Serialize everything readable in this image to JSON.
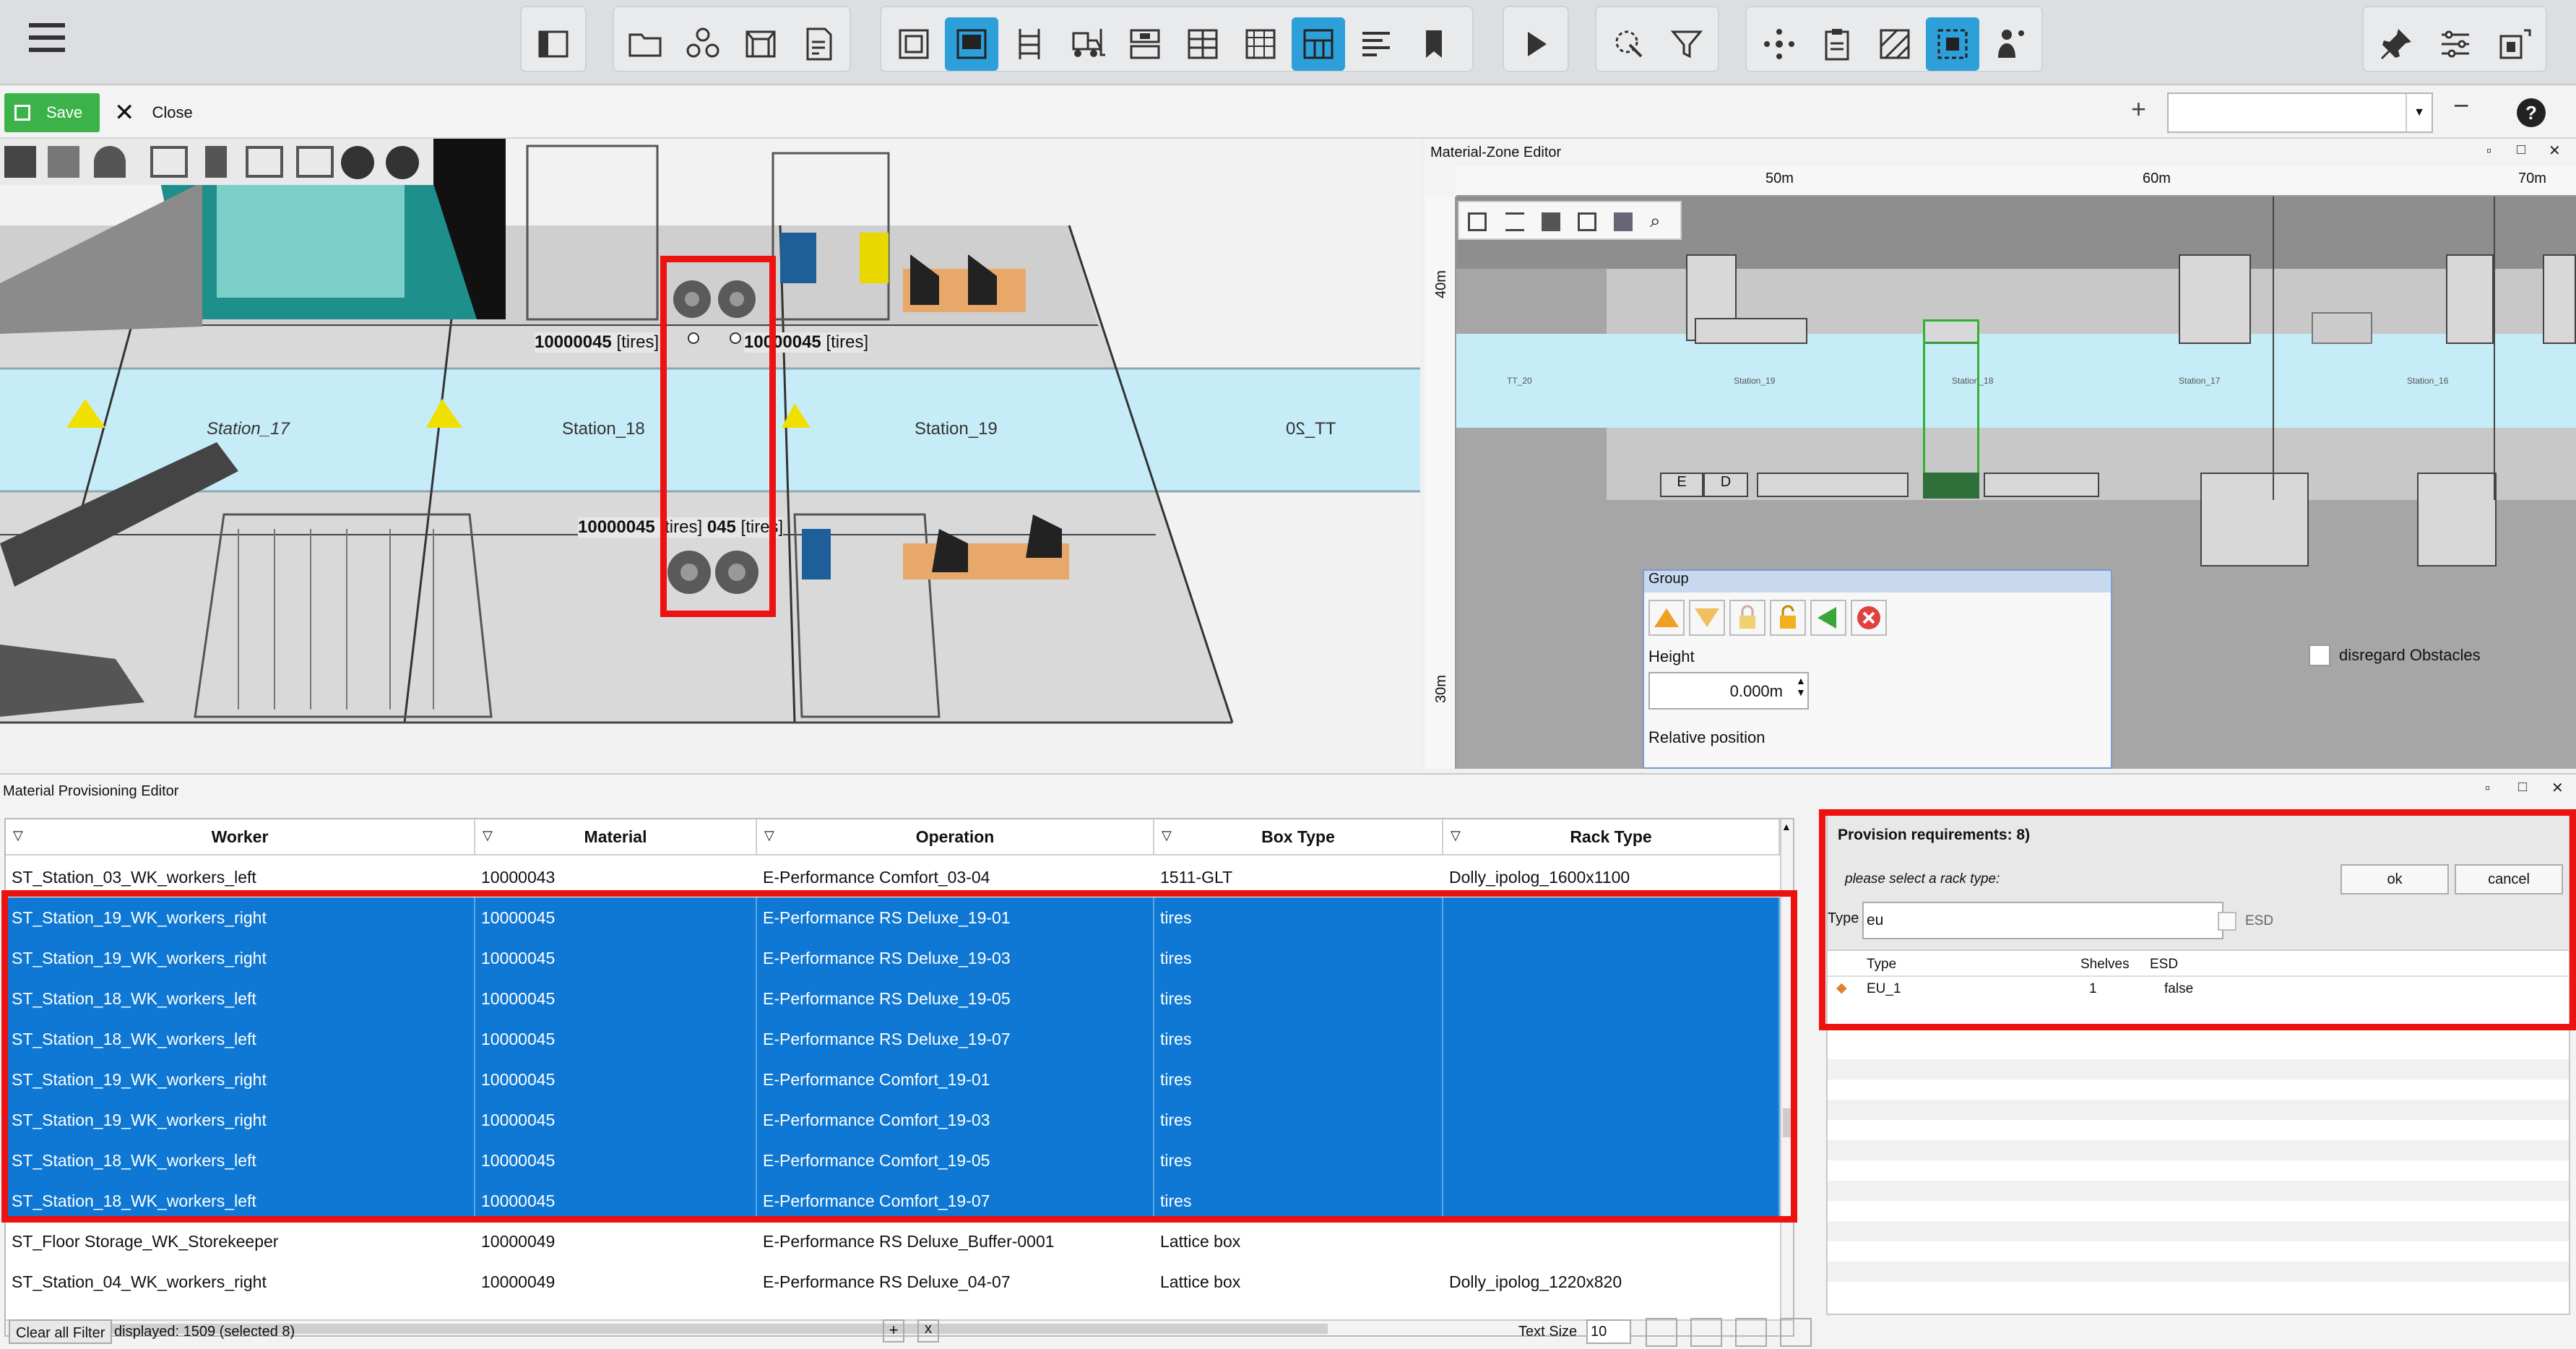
{
  "toolbar": {
    "icons": [
      "menu-icon",
      "panel-icon",
      "folder-open-icon",
      "objects-icon",
      "frame-icon",
      "report-icon",
      "layout-icon",
      "zone-icon",
      "rack-icon",
      "forklift-icon",
      "storage-icon",
      "grid-icon",
      "table-icon",
      "material-zone-icon",
      "align-icon",
      "bookmark-icon",
      "play-icon",
      "select-icon",
      "filter-icon",
      "points-icon",
      "clipboard-icon",
      "hatch-icon",
      "capture-icon",
      "worker-icon",
      "pin-icon",
      "settings-icon",
      "module-icon"
    ],
    "active_icons": [
      "layout-icon",
      "material-zone-icon",
      "capture-icon"
    ]
  },
  "bar2": {
    "save_label": "Save",
    "close_label": "Close",
    "plus": "+",
    "minus": "−",
    "help": "?"
  },
  "view3d": {
    "label_top_left": "10000045",
    "label_top_left_suffix": "[tires]",
    "label_top_right": "10000045",
    "label_top_right_suffix": "[tires]",
    "label_bottom_left": "10000045",
    "label_bottom_mid": "[tires]",
    "label_bottom_right": "045",
    "label_bottom_right_suffix": "[tires]",
    "stations": [
      "Station_17",
      "Station_18",
      "Station_19",
      "TT_20"
    ]
  },
  "mze": {
    "title": "Material-Zone Editor",
    "ruler_x": [
      "50m",
      "60m",
      "70m"
    ],
    "ruler_y": [
      "40m",
      "30m"
    ],
    "stations": [
      "TT_20",
      "Station_19",
      "Station_18",
      "Station_17",
      "Station_16"
    ],
    "labels_e": "E",
    "labels_d": "D",
    "group_title": "Group",
    "height_label": "Height",
    "height_value": "0.000m",
    "relative_position_label": "Relative position",
    "disregard_label": "disregard Obstacles"
  },
  "mpe": {
    "title": "Material Provisioning Editor",
    "columns": [
      "Worker",
      "Material",
      "Operation",
      "Box Type",
      "Rack Type"
    ],
    "rows": [
      {
        "worker": "ST_Station_03_WK_workers_left",
        "material": "10000043",
        "operation": "E-Performance Comfort_03-04",
        "box": "1511-GLT",
        "rack": "Dolly_ipolog_1600x1100",
        "sel": false
      },
      {
        "worker": "ST_Station_19_WK_workers_right",
        "material": "10000045",
        "operation": "E-Performance RS Deluxe_19-01",
        "box": "tires",
        "rack": "",
        "sel": true
      },
      {
        "worker": "ST_Station_19_WK_workers_right",
        "material": "10000045",
        "operation": "E-Performance RS Deluxe_19-03",
        "box": "tires",
        "rack": "",
        "sel": true
      },
      {
        "worker": "ST_Station_18_WK_workers_left",
        "material": "10000045",
        "operation": "E-Performance RS Deluxe_19-05",
        "box": "tires",
        "rack": "",
        "sel": true
      },
      {
        "worker": "ST_Station_18_WK_workers_left",
        "material": "10000045",
        "operation": "E-Performance RS Deluxe_19-07",
        "box": "tires",
        "rack": "",
        "sel": true
      },
      {
        "worker": "ST_Station_19_WK_workers_right",
        "material": "10000045",
        "operation": "E-Performance Comfort_19-01",
        "box": "tires",
        "rack": "",
        "sel": true
      },
      {
        "worker": "ST_Station_19_WK_workers_right",
        "material": "10000045",
        "operation": "E-Performance Comfort_19-03",
        "box": "tires",
        "rack": "",
        "sel": true
      },
      {
        "worker": "ST_Station_18_WK_workers_left",
        "material": "10000045",
        "operation": "E-Performance Comfort_19-05",
        "box": "tires",
        "rack": "",
        "sel": true
      },
      {
        "worker": "ST_Station_18_WK_workers_left",
        "material": "10000045",
        "operation": "E-Performance Comfort_19-07",
        "box": "tires",
        "rack": "",
        "sel": true
      },
      {
        "worker": "ST_Floor Storage_WK_Storekeeper",
        "material": "10000049",
        "operation": "E-Performance RS Deluxe_Buffer-0001",
        "box": "Lattice box",
        "rack": "",
        "sel": false
      },
      {
        "worker": "ST_Station_04_WK_workers_right",
        "material": "10000049",
        "operation": "E-Performance RS Deluxe_04-07",
        "box": "Lattice box",
        "rack": "Dolly_ipolog_1220x820",
        "sel": false
      }
    ],
    "clear_filter_label": "Clear all Filter",
    "displayed_text": "displayed: 1509 (selected 8)",
    "plus": "+",
    "x": "x",
    "text_size_label": "Text Size",
    "text_size_value": "10"
  },
  "provision": {
    "title": "Provision requirements: 8)",
    "prompt": "please select a rack type:",
    "ok_label": "ok",
    "cancel_label": "cancel",
    "type_label": "Type",
    "type_value": "eu",
    "esd_label": "ESD",
    "col_type": "Type",
    "col_shelves": "Shelves",
    "col_esd": "ESD",
    "result_type": "EU_1",
    "result_shelves": "1",
    "result_esd": "false"
  },
  "colors": {
    "accent": "#2d9fd9",
    "selection": "#0f78d4",
    "highlight": "#ee1111",
    "save": "#3cb34a",
    "lane": "#c6ecf8"
  }
}
